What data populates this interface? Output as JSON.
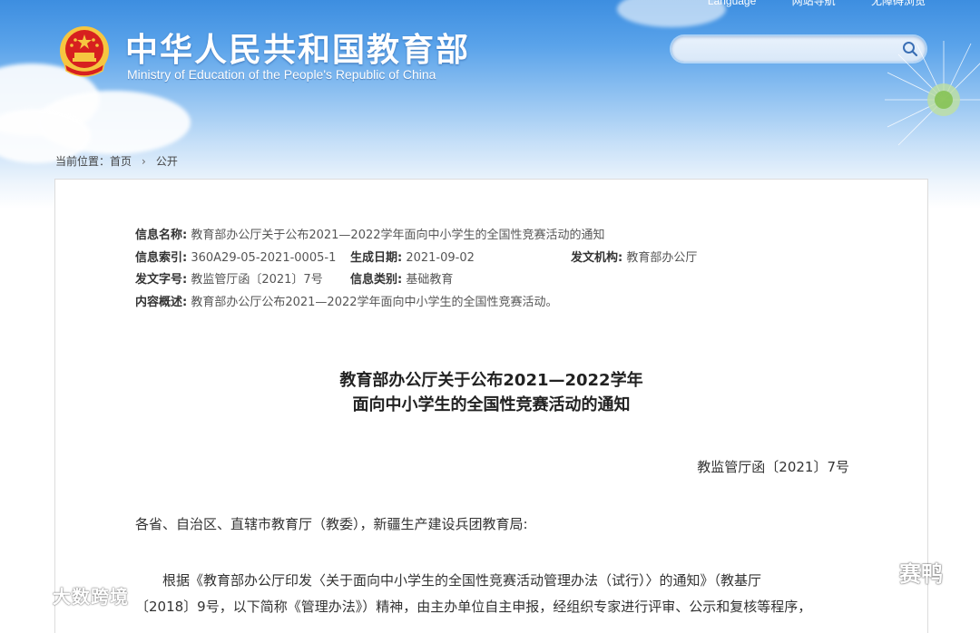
{
  "header": {
    "top_links": [
      "Language",
      "网站导航",
      "无障碍浏览"
    ],
    "title_cn": "中华人民共和国教育部",
    "title_en": "Ministry of Education of the People's Republic of China",
    "search": {
      "value": "",
      "placeholder": ""
    }
  },
  "breadcrumb": {
    "prefix": "当前位置：",
    "items": [
      "首页",
      "公开"
    ]
  },
  "meta": {
    "name_label": "信息名称:",
    "name_value": "教育部办公厅关于公布2021—2022学年面向中小学生的全国性竞赛活动的通知",
    "index_label": "信息索引:",
    "index_value": "360A29-05-2021-0005-1",
    "date_label": "生成日期:",
    "date_value": "2021-09-02",
    "org_label": "发文机构:",
    "org_value": "教育部办公厅",
    "docno_label": "发文字号:",
    "docno_value": "教监管厅函〔2021〕7号",
    "category_label": "信息类别:",
    "category_value": "基础教育",
    "summary_label": "内容概述:",
    "summary_value": "教育部办公厅公布2021—2022学年面向中小学生的全国性竞赛活动。"
  },
  "document": {
    "title_line1": "教育部办公厅关于公布2021—2022学年",
    "title_line2": "面向中小学生的全国性竞赛活动的通知",
    "doc_number": "教监管厅函〔2021〕7号",
    "salutation": "各省、自治区、直辖市教育厅（教委），新疆生产建设兵团教育局:",
    "para1_line1": "根据《教育部办公厅印发〈关于面向中小学生的全国性竞赛活动管理办法（试行）〉的通知》（教基厅",
    "para1_line2": "〔2018〕9号，以下简称《管理办法》）精神，由主办单位自主申报，经组织专家进行评审、公示和复核等程序，"
  },
  "watermarks": {
    "left": "大数跨境",
    "right": "赛鸭"
  },
  "colors": {
    "sky_top": "#3d8ee0",
    "emblem_red": "#d7201f",
    "emblem_gold": "#f6c640"
  }
}
